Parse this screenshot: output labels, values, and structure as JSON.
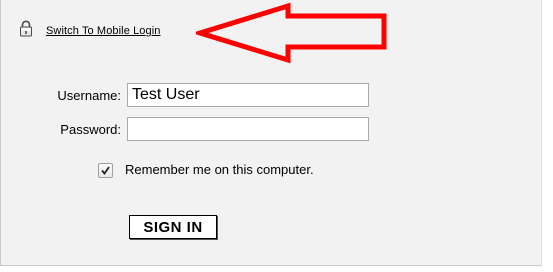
{
  "header": {
    "lock_icon": "lock-icon",
    "mobile_login_link": "Switch To Mobile Login",
    "annotation": {
      "icon": "red-arrow-left-icon",
      "color": "#ff0000"
    }
  },
  "form": {
    "username_label": "Username:",
    "username_value": "Test User",
    "password_label": "Password:",
    "password_value": "",
    "remember_checked": true,
    "remember_label": "Remember me on this computer.",
    "submit_label": "SIGN IN"
  },
  "colors": {
    "panel_background": "#f2f2f2",
    "panel_border": "#c8c8c8"
  }
}
